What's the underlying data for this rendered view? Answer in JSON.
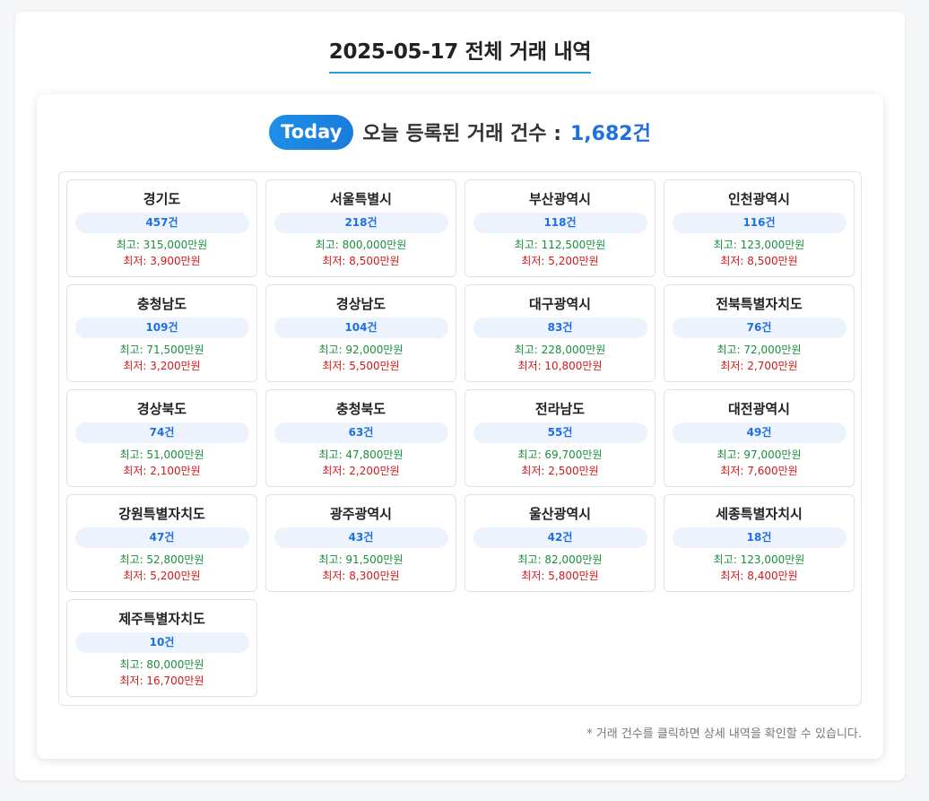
{
  "page": {
    "title": "2025-05-17 전체 거래 내역",
    "badge": "Today",
    "headline_text": "오늘 등록된 거래 건수 :",
    "headline_count": "1,682건",
    "footnote": "* 거래 건수를 클릭하면 상세 내역을 확인할 수 있습니다."
  },
  "regions": [
    {
      "name": "경기도",
      "count": "457건",
      "max": "최고: 315,000만원",
      "min": "최저: 3,900만원"
    },
    {
      "name": "서울특별시",
      "count": "218건",
      "max": "최고: 800,000만원",
      "min": "최저: 8,500만원"
    },
    {
      "name": "부산광역시",
      "count": "118건",
      "max": "최고: 112,500만원",
      "min": "최저: 5,200만원"
    },
    {
      "name": "인천광역시",
      "count": "116건",
      "max": "최고: 123,000만원",
      "min": "최저: 8,500만원"
    },
    {
      "name": "충청남도",
      "count": "109건",
      "max": "최고: 71,500만원",
      "min": "최저: 3,200만원"
    },
    {
      "name": "경상남도",
      "count": "104건",
      "max": "최고: 92,000만원",
      "min": "최저: 5,500만원"
    },
    {
      "name": "대구광역시",
      "count": "83건",
      "max": "최고: 228,000만원",
      "min": "최저: 10,800만원"
    },
    {
      "name": "전북특별자치도",
      "count": "76건",
      "max": "최고: 72,000만원",
      "min": "최저: 2,700만원"
    },
    {
      "name": "경상북도",
      "count": "74건",
      "max": "최고: 51,000만원",
      "min": "최저: 2,100만원"
    },
    {
      "name": "충청북도",
      "count": "63건",
      "max": "최고: 47,800만원",
      "min": "최저: 2,200만원"
    },
    {
      "name": "전라남도",
      "count": "55건",
      "max": "최고: 69,700만원",
      "min": "최저: 2,500만원"
    },
    {
      "name": "대전광역시",
      "count": "49건",
      "max": "최고: 97,000만원",
      "min": "최저: 7,600만원"
    },
    {
      "name": "강원특별자치도",
      "count": "47건",
      "max": "최고: 52,800만원",
      "min": "최저: 5,200만원"
    },
    {
      "name": "광주광역시",
      "count": "43건",
      "max": "최고: 91,500만원",
      "min": "최저: 8,300만원"
    },
    {
      "name": "울산광역시",
      "count": "42건",
      "max": "최고: 82,000만원",
      "min": "최저: 5,800만원"
    },
    {
      "name": "세종특별자치시",
      "count": "18건",
      "max": "최고: 123,000만원",
      "min": "최저: 8,400만원"
    },
    {
      "name": "제주특별자치도",
      "count": "10건",
      "max": "최고: 80,000만원",
      "min": "최저: 16,700만원"
    }
  ],
  "colors": {
    "accent": "#1e6fe0",
    "max_text": "#1b8f3e",
    "min_text": "#d11a1a",
    "title_underline": "#2a9fd6"
  }
}
